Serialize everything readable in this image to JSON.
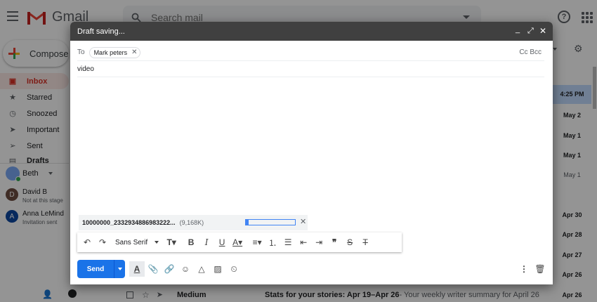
{
  "app": {
    "name": "Gmail"
  },
  "search": {
    "placeholder": "Search mail"
  },
  "sidebar": {
    "compose_label": "Compose",
    "items": [
      {
        "label": "Inbox",
        "icon": "inbox-icon"
      },
      {
        "label": "Starred",
        "icon": "star-icon"
      },
      {
        "label": "Snoozed",
        "icon": "clock-icon"
      },
      {
        "label": "Important",
        "icon": "important-icon"
      },
      {
        "label": "Sent",
        "icon": "send-icon"
      },
      {
        "label": "Drafts",
        "icon": "draft-icon"
      }
    ],
    "hangouts_user": "Beth",
    "contacts": [
      {
        "name": "David B",
        "status": "Not at this stage",
        "initial": "D"
      },
      {
        "name": "Anna LeMind",
        "status": "Invitation sent",
        "initial": "A"
      }
    ]
  },
  "list": {
    "dates": [
      "4:25 PM",
      "May 2",
      "May 1",
      "May 1",
      "May 1",
      "Apr 30",
      "Apr 28",
      "Apr 27",
      "Apr 26",
      "Apr 26"
    ],
    "last_row": {
      "sender": "Medium",
      "subject": "Stats for your stories: Apr 19–Apr 26",
      "snippet": " - Your weekly writer summary for April 26, ..."
    }
  },
  "compose": {
    "title": "Draft saving...",
    "to_label": "To",
    "recipient": "Mark peters",
    "cc_bcc": "Cc Bcc",
    "subject": "video",
    "attachment": {
      "name": "10000000_2332934886983222...",
      "size": "(9,168K)",
      "progress": 0.06
    },
    "font": "Sans Serif",
    "send_label": "Send"
  },
  "colors": {
    "accent": "#1a73e8",
    "inbox": "#d93025",
    "header": "#404040"
  }
}
